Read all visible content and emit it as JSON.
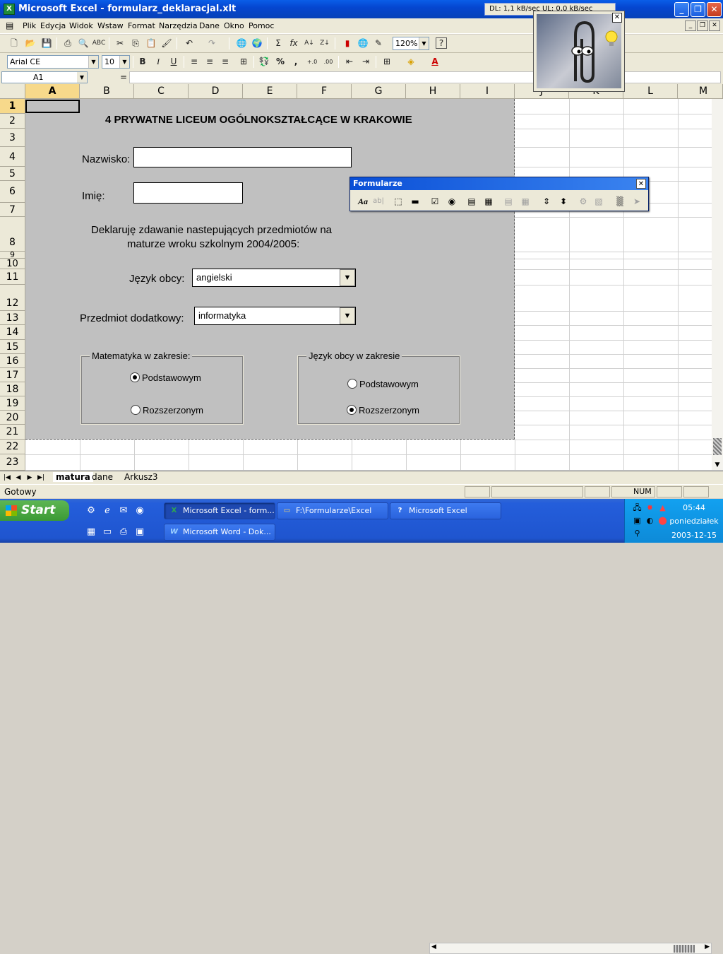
{
  "window": {
    "title": "Microsoft Excel - formularz_deklaracjal.xlt",
    "app_icon": "excel-icon"
  },
  "network_monitor": "DL: 1,1 kB/sec  UL: 0,0 kB/sec",
  "menu": [
    "Plik",
    "Edycja",
    "Widok",
    "Wstaw",
    "Format",
    "Narzędzia",
    "Dane",
    "Okno",
    "Pomoc"
  ],
  "toolbar": {
    "zoom": "120%",
    "font": "Arial CE",
    "font_size": "10",
    "bold": "B",
    "italic": "I",
    "underline": "U"
  },
  "formula_bar": {
    "name_box": "A1",
    "equals": "="
  },
  "columns": [
    "A",
    "B",
    "C",
    "D",
    "E",
    "F",
    "G",
    "H",
    "I",
    "J",
    "K",
    "L",
    "M"
  ],
  "rows": [
    "1",
    "2",
    "3",
    "4",
    "5",
    "6",
    "7",
    "8",
    "9",
    "10",
    "11",
    "12",
    "13",
    "14",
    "15",
    "16",
    "17",
    "18",
    "19",
    "20",
    "21",
    "22",
    "23"
  ],
  "form": {
    "title": "4 PRYWATNE LICEUM OGÓLNOKSZTAŁCĄCE W KRAKOWIE",
    "surname_label": "Nazwisko:",
    "surname_value": "",
    "name_label": "Imię:",
    "name_value": "",
    "declaration_line1": "Deklaruję zdawanie nastepujących przedmiotów na",
    "declaration_line2": "maturze wroku szkolnym 2004/2005:",
    "language_label": "Język obcy:",
    "language_value": "angielski",
    "extra_subject_label": "Przedmiot dodatkowy:",
    "extra_subject_value": "informatyka",
    "math_group": {
      "title": "Matematyka w zakresie:",
      "option_basic": "Podstawowym",
      "option_extended": "Rozszerzonym",
      "selected": "Podstawowym"
    },
    "language_group": {
      "title": "Język obcy w zakresie",
      "option_basic": "Podstawowym",
      "option_extended": "Rozszerzonym",
      "selected": "Rozszerzonym"
    }
  },
  "forms_toolbar": {
    "title": "Formularze"
  },
  "sheet_tabs": [
    "matura",
    "dane",
    "Arkusz3"
  ],
  "active_sheet": "matura",
  "status": {
    "text": "Gotowy",
    "num": "NUM"
  },
  "taskbar": {
    "start": "Start",
    "tasks": [
      {
        "label": "Microsoft Excel - form...",
        "icon": "excel-icon",
        "active": true
      },
      {
        "label": "F:\\Formularze\\Excel",
        "icon": "folder-icon",
        "active": false
      },
      {
        "label": "Microsoft Excel",
        "icon": "help-icon",
        "active": false
      },
      {
        "label": "Microsoft Word - Dok...",
        "icon": "word-icon",
        "active": false
      }
    ],
    "clock": {
      "time": "05:44",
      "day": "poniedziałek",
      "date": "2003-12-15"
    }
  }
}
